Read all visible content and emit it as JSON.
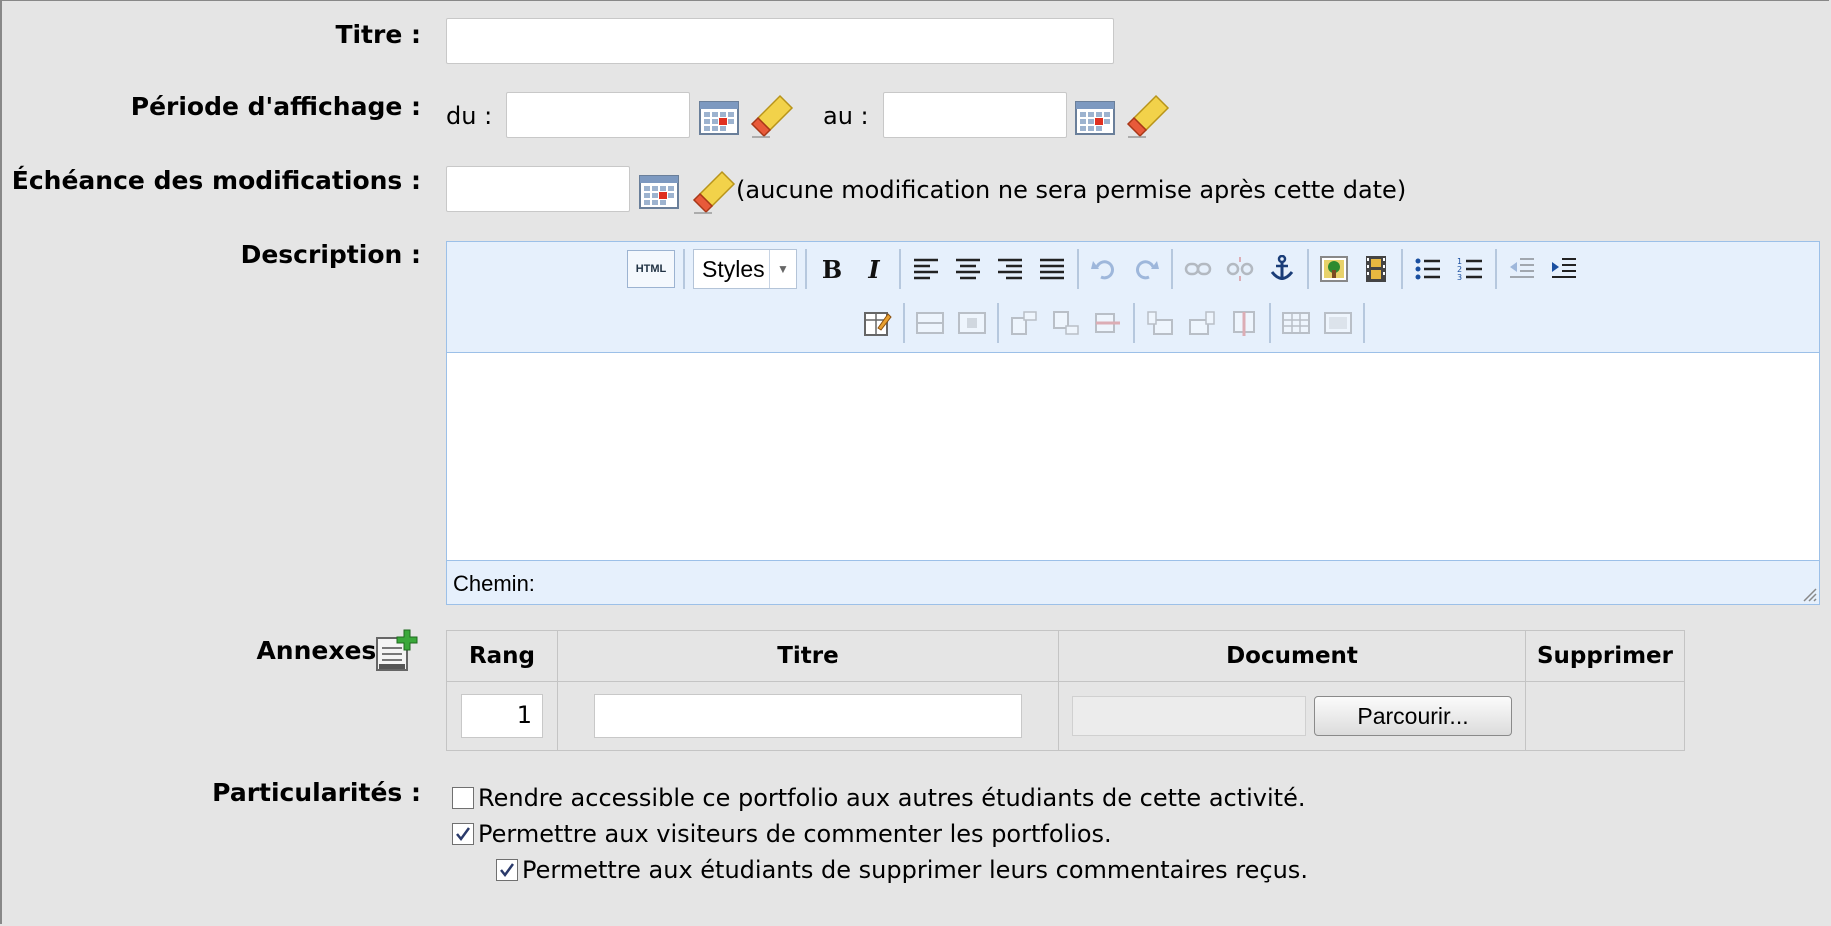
{
  "form": {
    "title_label": "Titre :",
    "period_label": "Période d'affichage :",
    "period_from": "du :",
    "period_to": "au :",
    "deadline_label": "Échéance des modifications :",
    "deadline_note": "(aucune modification ne sera permise après cette date)",
    "description_label": "Description :",
    "annexes_label": "Annexes :",
    "particularites_label": "Particularités :"
  },
  "editor": {
    "html_button": "HTML",
    "styles_dropdown": "Styles",
    "bold": "B",
    "italic": "I",
    "status_path": "Chemin:"
  },
  "annexes_table": {
    "headers": [
      "Rang",
      "Titre",
      "Document",
      "Supprimer"
    ],
    "rows": [
      {
        "rang": "1",
        "titre": "",
        "browse_label": "Parcourir..."
      }
    ]
  },
  "options": [
    {
      "label": "Rendre accessible ce portfolio aux autres étudiants de cette activité.",
      "checked": false
    },
    {
      "label": "Permettre aux visiteurs de commenter les portfolios.",
      "checked": true
    },
    {
      "label": "Permettre aux étudiants de supprimer leurs commentaires reçus.",
      "checked": true
    }
  ],
  "colors": {
    "background": "#e5e5e5",
    "editor_toolbar": "#e6f0fc",
    "editor_border": "#9cc0e8"
  }
}
